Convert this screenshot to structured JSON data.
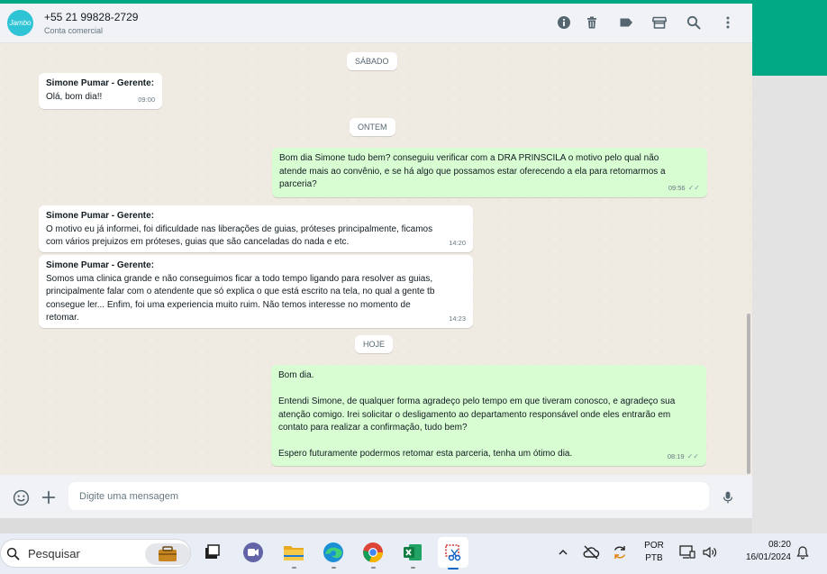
{
  "header": {
    "avatar_text": "Jambo",
    "contact_name": "+55 21 99828-2729",
    "contact_subtitle": "Conta comercial",
    "icons": [
      "info-icon",
      "trash-icon",
      "label-icon",
      "store-icon",
      "search-icon",
      "more-vertical-icon"
    ]
  },
  "chat": {
    "dates": {
      "sabado": "SÁBADO",
      "ontem": "ONTEM",
      "hoje": "HOJE"
    },
    "messages": [
      {
        "sender": "Simone Pumar - Gerente:",
        "text": "Olá, bom dia!!",
        "time": "09:00"
      },
      {
        "text": "Bom dia Simone tudo bem? conseguiu verificar com a DRA PRINSCILA o motivo pelo qual não\natende mais ao convênio, e se há algo que possamos estar oferecendo a ela para retomarmos a\nparceria?",
        "time": "09:56"
      },
      {
        "sender": "Simone Pumar - Gerente:",
        "text": "O motivo eu já informei, foi dificuldade nas liberações de guias, próteses principalmente, ficamos\ncom vários prejuizos em próteses, guias que são canceladas do nada e etc.",
        "time": "14:20"
      },
      {
        "sender": "Simone Pumar - Gerente:",
        "text": "Somos uma clinica grande e não conseguimos ficar a todo tempo ligando para resolver as guias,\nprincipalmente falar com o atendente que só explica o que está escrito na tela, no qual a gente tb\nconsegue ler... Enfim, foi uma experiencia muito ruim. Não temos interesse no momento de\nretomar.",
        "time": "14:23"
      },
      {
        "text": "Bom dia.\n\nEntendi Simone, de qualquer forma agradeço pelo tempo em que tiveram conosco, e agradeço sua\natenção comigo. Irei solicitar o desligamento ao departamento responsável onde eles entrarão em\ncontato para realizar a confirmação, tudo bem?\n\nEspero futuramente podermos retomar esta parceria, tenha um ótimo dia.",
        "time": "08:19"
      }
    ]
  },
  "composer": {
    "placeholder": "Digite uma mensagem"
  },
  "taskbar": {
    "search_label": "Pesquisar",
    "lang_top": "POR",
    "lang_bottom": "PTB",
    "clock_time": "08:20",
    "clock_date": "16/01/2024"
  }
}
